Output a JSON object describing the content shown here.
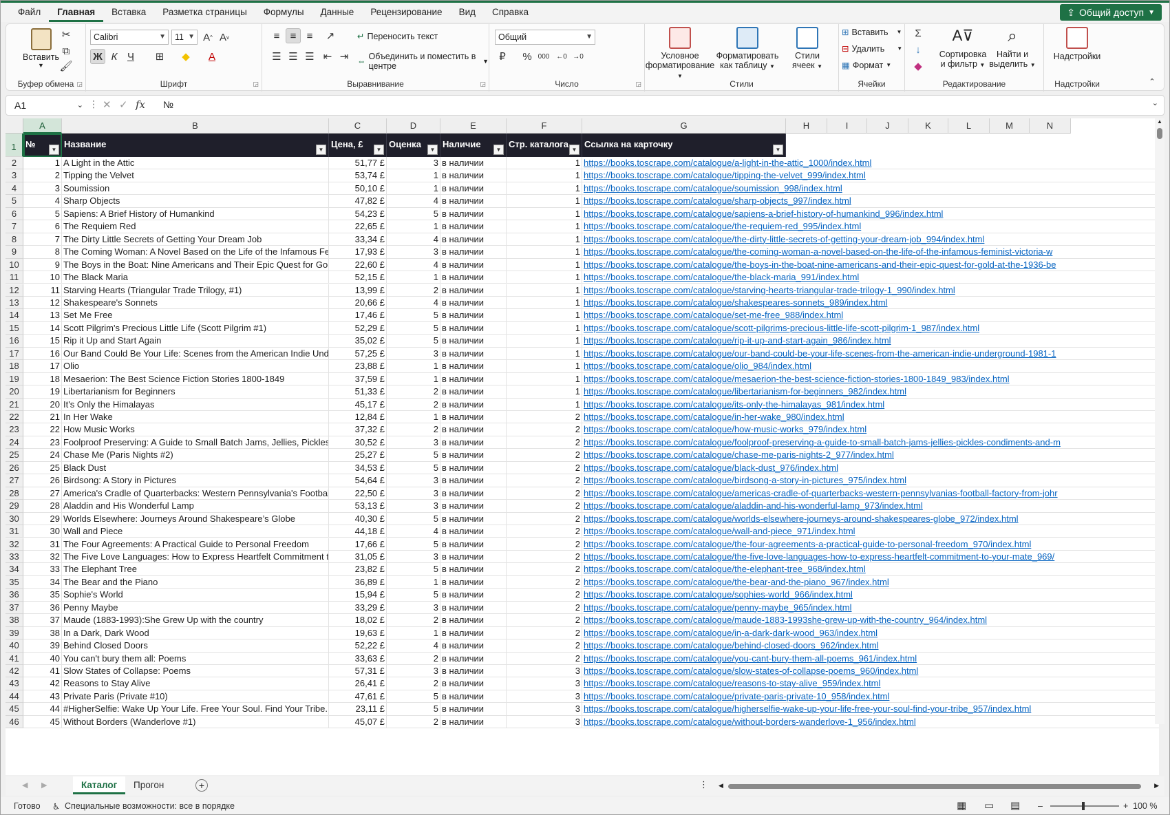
{
  "menu": [
    "Файл",
    "Главная",
    "Вставка",
    "Разметка страницы",
    "Формулы",
    "Данные",
    "Рецензирование",
    "Вид",
    "Справка"
  ],
  "share_label": "Общий доступ",
  "ribbon": {
    "clipboard": {
      "label": "Буфер обмена",
      "paste": "Вставить"
    },
    "font": {
      "label": "Шрифт",
      "name": "Calibri",
      "size": "11",
      "bold": "Ж",
      "italic": "К",
      "underline": "Ч"
    },
    "alignment": {
      "label": "Выравнивание",
      "wrap": "Переносить текст",
      "merge": "Объединить и поместить в центре"
    },
    "number": {
      "label": "Число",
      "format": "Общий"
    },
    "styles": {
      "label": "Стили",
      "conditional": [
        "Условное",
        "форматирование"
      ],
      "as_table": [
        "Форматировать",
        "как таблицу"
      ],
      "cell_styles": [
        "Стили",
        "ячеек"
      ]
    },
    "cells": {
      "label": "Ячейки",
      "insert": "Вставить",
      "delete": "Удалить",
      "format": "Формат"
    },
    "editing": {
      "label": "Редактирование",
      "sort": [
        "Сортировка",
        "и фильтр"
      ],
      "find": [
        "Найти и",
        "выделить"
      ]
    },
    "addins": {
      "label": "Надстройки",
      "button": "Надстройки"
    }
  },
  "formula_bar": {
    "name_box": "A1",
    "value": "№"
  },
  "columns": [
    "A",
    "B",
    "C",
    "D",
    "E",
    "F",
    "G",
    "H",
    "I",
    "J",
    "K",
    "L",
    "M",
    "N"
  ],
  "headers": [
    "№",
    "Название",
    "Цена, £",
    "Оценка",
    "Наличие",
    "Стр. каталога",
    "Ссылка на карточку"
  ],
  "rows": [
    [
      "1",
      "A Light in the Attic",
      "51,77 £",
      "3",
      "в наличии",
      "1",
      "https://books.toscrape.com/catalogue/a-light-in-the-attic_1000/index.html"
    ],
    [
      "2",
      "Tipping the Velvet",
      "53,74 £",
      "1",
      "в наличии",
      "1",
      "https://books.toscrape.com/catalogue/tipping-the-velvet_999/index.html"
    ],
    [
      "3",
      "Soumission",
      "50,10 £",
      "1",
      "в наличии",
      "1",
      "https://books.toscrape.com/catalogue/soumission_998/index.html"
    ],
    [
      "4",
      "Sharp Objects",
      "47,82 £",
      "4",
      "в наличии",
      "1",
      "https://books.toscrape.com/catalogue/sharp-objects_997/index.html"
    ],
    [
      "5",
      "Sapiens: A Brief History of Humankind",
      "54,23 £",
      "5",
      "в наличии",
      "1",
      "https://books.toscrape.com/catalogue/sapiens-a-brief-history-of-humankind_996/index.html"
    ],
    [
      "6",
      "The Requiem Red",
      "22,65 £",
      "1",
      "в наличии",
      "1",
      "https://books.toscrape.com/catalogue/the-requiem-red_995/index.html"
    ],
    [
      "7",
      "The Dirty Little Secrets of Getting Your Dream Job",
      "33,34 £",
      "4",
      "в наличии",
      "1",
      "https://books.toscrape.com/catalogue/the-dirty-little-secrets-of-getting-your-dream-job_994/index.html"
    ],
    [
      "8",
      "The Coming Woman: A Novel Based on the Life of the Infamous Fem",
      "17,93 £",
      "3",
      "в наличии",
      "1",
      "https://books.toscrape.com/catalogue/the-coming-woman-a-novel-based-on-the-life-of-the-infamous-feminist-victoria-w"
    ],
    [
      "9",
      "The Boys in the Boat: Nine Americans and Their Epic Quest for Gold a",
      "22,60 £",
      "4",
      "в наличии",
      "1",
      "https://books.toscrape.com/catalogue/the-boys-in-the-boat-nine-americans-and-their-epic-quest-for-gold-at-the-1936-be"
    ],
    [
      "10",
      "The Black Maria",
      "52,15 £",
      "1",
      "в наличии",
      "1",
      "https://books.toscrape.com/catalogue/the-black-maria_991/index.html"
    ],
    [
      "11",
      "Starving Hearts (Triangular Trade Trilogy, #1)",
      "13,99 £",
      "2",
      "в наличии",
      "1",
      "https://books.toscrape.com/catalogue/starving-hearts-triangular-trade-trilogy-1_990/index.html"
    ],
    [
      "12",
      "Shakespeare's Sonnets",
      "20,66 £",
      "4",
      "в наличии",
      "1",
      "https://books.toscrape.com/catalogue/shakespeares-sonnets_989/index.html"
    ],
    [
      "13",
      "Set Me Free",
      "17,46 £",
      "5",
      "в наличии",
      "1",
      "https://books.toscrape.com/catalogue/set-me-free_988/index.html"
    ],
    [
      "14",
      "Scott Pilgrim's Precious Little Life (Scott Pilgrim #1)",
      "52,29 £",
      "5",
      "в наличии",
      "1",
      "https://books.toscrape.com/catalogue/scott-pilgrims-precious-little-life-scott-pilgrim-1_987/index.html"
    ],
    [
      "15",
      "Rip it Up and Start Again",
      "35,02 £",
      "5",
      "в наличии",
      "1",
      "https://books.toscrape.com/catalogue/rip-it-up-and-start-again_986/index.html"
    ],
    [
      "16",
      "Our Band Could Be Your Life: Scenes from the American Indie Under",
      "57,25 £",
      "3",
      "в наличии",
      "1",
      "https://books.toscrape.com/catalogue/our-band-could-be-your-life-scenes-from-the-american-indie-underground-1981-1"
    ],
    [
      "17",
      "Olio",
      "23,88 £",
      "1",
      "в наличии",
      "1",
      "https://books.toscrape.com/catalogue/olio_984/index.html"
    ],
    [
      "18",
      "Mesaerion: The Best Science Fiction Stories 1800-1849",
      "37,59 £",
      "1",
      "в наличии",
      "1",
      "https://books.toscrape.com/catalogue/mesaerion-the-best-science-fiction-stories-1800-1849_983/index.html"
    ],
    [
      "19",
      "Libertarianism for Beginners",
      "51,33 £",
      "2",
      "в наличии",
      "1",
      "https://books.toscrape.com/catalogue/libertarianism-for-beginners_982/index.html"
    ],
    [
      "20",
      "It's Only the Himalayas",
      "45,17 £",
      "2",
      "в наличии",
      "1",
      "https://books.toscrape.com/catalogue/its-only-the-himalayas_981/index.html"
    ],
    [
      "21",
      "In Her Wake",
      "12,84 £",
      "1",
      "в наличии",
      "2",
      "https://books.toscrape.com/catalogue/in-her-wake_980/index.html"
    ],
    [
      "22",
      "How Music Works",
      "37,32 £",
      "2",
      "в наличии",
      "2",
      "https://books.toscrape.com/catalogue/how-music-works_979/index.html"
    ],
    [
      "23",
      "Foolproof Preserving: A Guide to Small Batch Jams, Jellies, Pickles, C",
      "30,52 £",
      "3",
      "в наличии",
      "2",
      "https://books.toscrape.com/catalogue/foolproof-preserving-a-guide-to-small-batch-jams-jellies-pickles-condiments-and-m"
    ],
    [
      "24",
      "Chase Me (Paris Nights #2)",
      "25,27 £",
      "5",
      "в наличии",
      "2",
      "https://books.toscrape.com/catalogue/chase-me-paris-nights-2_977/index.html"
    ],
    [
      "25",
      "Black Dust",
      "34,53 £",
      "5",
      "в наличии",
      "2",
      "https://books.toscrape.com/catalogue/black-dust_976/index.html"
    ],
    [
      "26",
      "Birdsong: A Story in Pictures",
      "54,64 £",
      "3",
      "в наличии",
      "2",
      "https://books.toscrape.com/catalogue/birdsong-a-story-in-pictures_975/index.html"
    ],
    [
      "27",
      "America's Cradle of Quarterbacks: Western Pennsylvania's Football F",
      "22,50 £",
      "3",
      "в наличии",
      "2",
      "https://books.toscrape.com/catalogue/americas-cradle-of-quarterbacks-western-pennsylvanias-football-factory-from-johr"
    ],
    [
      "28",
      "Aladdin and His Wonderful Lamp",
      "53,13 £",
      "3",
      "в наличии",
      "2",
      "https://books.toscrape.com/catalogue/aladdin-and-his-wonderful-lamp_973/index.html"
    ],
    [
      "29",
      "Worlds Elsewhere: Journeys Around Shakespeare’s Globe",
      "40,30 £",
      "5",
      "в наличии",
      "2",
      "https://books.toscrape.com/catalogue/worlds-elsewhere-journeys-around-shakespeares-globe_972/index.html"
    ],
    [
      "30",
      "Wall and Piece",
      "44,18 £",
      "4",
      "в наличии",
      "2",
      "https://books.toscrape.com/catalogue/wall-and-piece_971/index.html"
    ],
    [
      "31",
      "The Four Agreements: A Practical Guide to Personal Freedom",
      "17,66 £",
      "5",
      "в наличии",
      "2",
      "https://books.toscrape.com/catalogue/the-four-agreements-a-practical-guide-to-personal-freedom_970/index.html"
    ],
    [
      "32",
      "The Five Love Languages: How to Express Heartfelt Commitment to Y",
      "31,05 £",
      "3",
      "в наличии",
      "2",
      "https://books.toscrape.com/catalogue/the-five-love-languages-how-to-express-heartfelt-commitment-to-your-mate_969/"
    ],
    [
      "33",
      "The Elephant Tree",
      "23,82 £",
      "5",
      "в наличии",
      "2",
      "https://books.toscrape.com/catalogue/the-elephant-tree_968/index.html"
    ],
    [
      "34",
      "The Bear and the Piano",
      "36,89 £",
      "1",
      "в наличии",
      "2",
      "https://books.toscrape.com/catalogue/the-bear-and-the-piano_967/index.html"
    ],
    [
      "35",
      "Sophie's World",
      "15,94 £",
      "5",
      "в наличии",
      "2",
      "https://books.toscrape.com/catalogue/sophies-world_966/index.html"
    ],
    [
      "36",
      "Penny Maybe",
      "33,29 £",
      "3",
      "в наличии",
      "2",
      "https://books.toscrape.com/catalogue/penny-maybe_965/index.html"
    ],
    [
      "37",
      "Maude (1883-1993):She Grew Up with the country",
      "18,02 £",
      "2",
      "в наличии",
      "2",
      "https://books.toscrape.com/catalogue/maude-1883-1993she-grew-up-with-the-country_964/index.html"
    ],
    [
      "38",
      "In a Dark, Dark Wood",
      "19,63 £",
      "1",
      "в наличии",
      "2",
      "https://books.toscrape.com/catalogue/in-a-dark-dark-wood_963/index.html"
    ],
    [
      "39",
      "Behind Closed Doors",
      "52,22 £",
      "4",
      "в наличии",
      "2",
      "https://books.toscrape.com/catalogue/behind-closed-doors_962/index.html"
    ],
    [
      "40",
      "You can't bury them all: Poems",
      "33,63 £",
      "2",
      "в наличии",
      "2",
      "https://books.toscrape.com/catalogue/you-cant-bury-them-all-poems_961/index.html"
    ],
    [
      "41",
      "Slow States of Collapse: Poems",
      "57,31 £",
      "3",
      "в наличии",
      "3",
      "https://books.toscrape.com/catalogue/slow-states-of-collapse-poems_960/index.html"
    ],
    [
      "42",
      "Reasons to Stay Alive",
      "26,41 £",
      "2",
      "в наличии",
      "3",
      "https://books.toscrape.com/catalogue/reasons-to-stay-alive_959/index.html"
    ],
    [
      "43",
      "Private Paris (Private #10)",
      "47,61 £",
      "5",
      "в наличии",
      "3",
      "https://books.toscrape.com/catalogue/private-paris-private-10_958/index.html"
    ],
    [
      "44",
      "#HigherSelfie: Wake Up Your Life. Free Your Soul. Find Your Tribe.",
      "23,11 £",
      "5",
      "в наличии",
      "3",
      "https://books.toscrape.com/catalogue/higherselfie-wake-up-your-life-free-your-soul-find-your-tribe_957/index.html"
    ],
    [
      "45",
      "Without Borders (Wanderlove #1)",
      "45,07 £",
      "2",
      "в наличии",
      "3",
      "https://books.toscrape.com/catalogue/without-borders-wanderlove-1_956/index.html"
    ]
  ],
  "sheets": [
    "Каталог",
    "Прогон"
  ],
  "status": {
    "ready": "Готово",
    "accessibility": "Специальные возможности: все в порядке",
    "zoom": "100 %"
  }
}
